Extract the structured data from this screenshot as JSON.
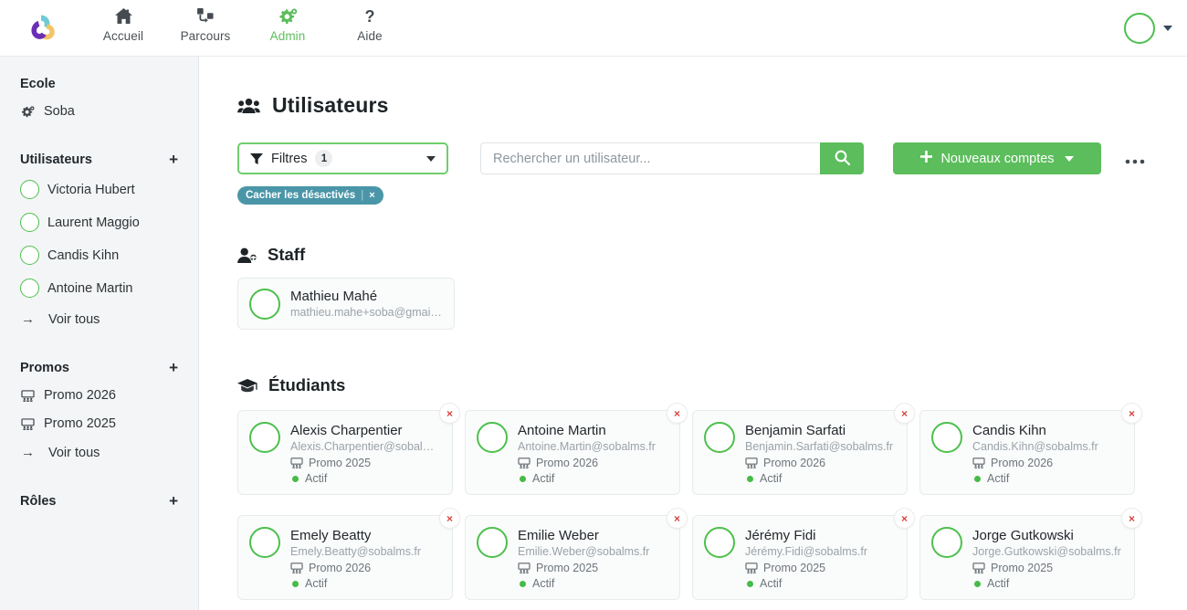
{
  "brand": {
    "logo_icon": "pinwheel-logo",
    "colors": {
      "purple": "#6b2fb5",
      "teal": "#6fcbd6",
      "yellow": "#f3c564",
      "green": "#5cbd5c",
      "chip_teal": "#4a96a8",
      "danger": "#d9443f"
    }
  },
  "topnav": {
    "items": [
      {
        "label": "Accueil",
        "icon": "home-icon",
        "active": false
      },
      {
        "label": "Parcours",
        "icon": "route-icon",
        "active": false
      },
      {
        "label": "Admin",
        "icon": "gears-icon",
        "active": true
      },
      {
        "label": "Aide",
        "icon": "question-mark-icon",
        "active": false
      }
    ],
    "account": {
      "avatar_icon": "user-avatar",
      "caret_icon": "chevron-down-icon"
    }
  },
  "sidebar": {
    "school": {
      "title": "Ecole",
      "item": {
        "label": "Soba",
        "icon": "gears-icon"
      }
    },
    "users": {
      "title": "Utilisateurs",
      "add_icon": "plus-icon",
      "items": [
        {
          "label": "Victoria Hubert",
          "icon": "avatar"
        },
        {
          "label": "Laurent Maggio",
          "icon": "avatar"
        },
        {
          "label": "Candis Kihn",
          "icon": "avatar"
        },
        {
          "label": "Antoine Martin",
          "icon": "avatar"
        }
      ],
      "see_all": {
        "label": "Voir tous",
        "icon": "arrow-right-icon"
      }
    },
    "promos": {
      "title": "Promos",
      "add_icon": "plus-icon",
      "items": [
        {
          "label": "Promo 2026",
          "icon": "classroom-icon"
        },
        {
          "label": "Promo 2025",
          "icon": "classroom-icon"
        }
      ],
      "see_all": {
        "label": "Voir tous",
        "icon": "arrow-right-icon"
      }
    },
    "roles": {
      "title": "Rôles",
      "add_icon": "plus-icon"
    }
  },
  "main": {
    "page_title": "Utilisateurs",
    "page_title_icon": "users-group-icon",
    "toolbar": {
      "filters": {
        "label": "Filtres",
        "count": "1",
        "icon": "funnel-icon",
        "caret_icon": "chevron-down-icon"
      },
      "search": {
        "placeholder": "Rechercher un utilisateur...",
        "value": "",
        "button_icon": "search-icon"
      },
      "new_accounts": {
        "label": "Nouveaux comptes",
        "plus_icon": "plus-icon",
        "caret_icon": "chevron-down-icon"
      },
      "more": {
        "label": "•••",
        "icon": "ellipsis-icon"
      }
    },
    "active_filters": [
      {
        "label": "Cacher les désactivés",
        "separator": "|",
        "remove_icon": "×"
      }
    ],
    "staff": {
      "title": "Staff",
      "icon": "user-plus-icon",
      "members": [
        {
          "name": "Mathieu Mahé",
          "email": "mathieu.mahe+soba@gmail....",
          "avatar": "female-blonde"
        }
      ]
    },
    "students": {
      "title": "Étudiants",
      "icon": "graduation-cap-icon",
      "promo_icon": "classroom-icon",
      "status_label": "Actif",
      "delete_icon": "×",
      "cards": [
        {
          "name": "Alexis Charpentier",
          "email": "Alexis.Charpentier@sobalm...",
          "promo": "Promo 2025",
          "status": "Actif",
          "avatar": "male-dark"
        },
        {
          "name": "Antoine Martin",
          "email": "Antoine.Martin@sobalms.fr",
          "promo": "Promo 2026",
          "status": "Actif",
          "avatar": "male-brown"
        },
        {
          "name": "Benjamin Sarfati",
          "email": "Benjamin.Sarfati@sobalms.fr",
          "promo": "Promo 2026",
          "status": "Actif",
          "avatar": "female-dark"
        },
        {
          "name": "Candis Kihn",
          "email": "Candis.Kihn@sobalms.fr",
          "promo": "Promo 2026",
          "status": "Actif",
          "avatar": "female-brown"
        },
        {
          "name": "Emely Beatty",
          "email": "Emely.Beatty@sobalms.fr",
          "promo": "Promo 2026",
          "status": "Actif",
          "avatar": "female-dark"
        },
        {
          "name": "Emilie Weber",
          "email": "Emilie.Weber@sobalms.fr",
          "promo": "Promo 2025",
          "status": "Actif",
          "avatar": "female-brown"
        },
        {
          "name": "Jérémy Fidi",
          "email": "Jérémy.Fidi@sobalms.fr",
          "promo": "Promo 2025",
          "status": "Actif",
          "avatar": "male-dark"
        },
        {
          "name": "Jorge Gutkowski",
          "email": "Jorge.Gutkowski@sobalms.fr",
          "promo": "Promo 2025",
          "status": "Actif",
          "avatar": "male-brown"
        }
      ]
    }
  }
}
